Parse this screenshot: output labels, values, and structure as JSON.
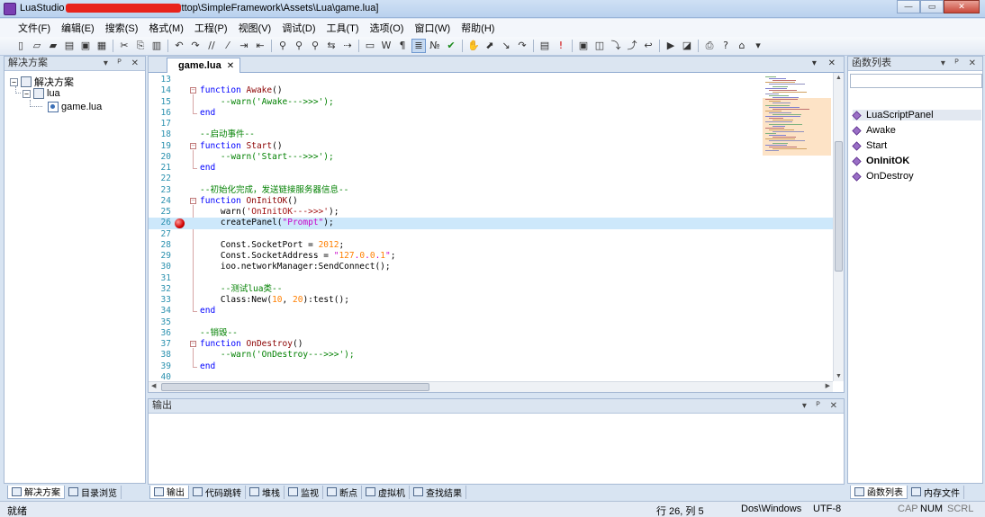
{
  "window": {
    "title_prefix": "LuaStudio",
    "title_suffix": "ttop\\SimpleFramework\\Assets\\Lua\\game.lua]",
    "minimize": "—",
    "maximize": "▭",
    "close": "✕"
  },
  "menu": [
    "文件(F)",
    "编辑(E)",
    "搜索(S)",
    "格式(M)",
    "工程(P)",
    "视图(V)",
    "调试(D)",
    "工具(T)",
    "选项(O)",
    "窗口(W)",
    "帮助(H)"
  ],
  "toolbar_icons": [
    "new-file-icon",
    "open-icon",
    "open-folder-icon",
    "open-project-icon",
    "save-icon",
    "save-all-icon",
    "sep",
    "cut-icon",
    "copy-icon",
    "paste-icon",
    "sep",
    "undo-icon",
    "redo-icon",
    "comment-icon",
    "uncomment-icon",
    "indent-icon",
    "outdent-icon",
    "sep",
    "find-icon",
    "find-next-icon",
    "find-prev-icon",
    "replace-icon",
    "goto-icon",
    "sep",
    "view-icon",
    "whitespace-icon",
    "paragraph-icon",
    "wrap-icon",
    "linenumber-icon",
    "check-icon",
    "sep",
    "hand-icon",
    "breakpoint-icon",
    "step-icon",
    "step-over-icon",
    "sep",
    "stack-icon",
    "exclamation-icon",
    "sep",
    "frame-icon",
    "watch-icon",
    "step-in-icon",
    "step-out-icon",
    "return-icon",
    "sep",
    "run-icon",
    "debug-icon",
    "sep",
    "print-icon",
    "help-icon",
    "home-icon",
    "more-icon"
  ],
  "solution": {
    "header": "解决方案",
    "root": "解决方案",
    "folder": "lua",
    "file": "game.lua"
  },
  "panel_buttons": "▾ ᴾ ✕",
  "editor": {
    "tab": "game.lua",
    "tab_close": "✕",
    "strip_buttons": "▾ ✕",
    "breakpoint_line": 26
  },
  "code": [
    {
      "n": "13",
      "t": ""
    },
    {
      "n": "14",
      "t": "function Awake()"
    },
    {
      "n": "15",
      "t": "    --warn('Awake--->>>');"
    },
    {
      "n": "16",
      "t": "end"
    },
    {
      "n": "17",
      "t": ""
    },
    {
      "n": "18",
      "t": "--启动事件--"
    },
    {
      "n": "19",
      "t": "function Start()"
    },
    {
      "n": "20",
      "t": "    --warn('Start--->>>');"
    },
    {
      "n": "21",
      "t": "end"
    },
    {
      "n": "22",
      "t": ""
    },
    {
      "n": "23",
      "t": "--初始化完成，发送链接服务器信息--"
    },
    {
      "n": "24",
      "t": "function OnInitOK()"
    },
    {
      "n": "25",
      "t": "    warn('OnInitOK--->>>');"
    },
    {
      "n": "26",
      "t": "    createPanel(\"Prompt\");"
    },
    {
      "n": "27",
      "t": ""
    },
    {
      "n": "28",
      "t": "    Const.SocketPort = 2012;"
    },
    {
      "n": "29",
      "t": "    Const.SocketAddress = \"127.0.0.1\";"
    },
    {
      "n": "30",
      "t": "    ioo.networkManager:SendConnect();"
    },
    {
      "n": "31",
      "t": ""
    },
    {
      "n": "32",
      "t": "    --测试lua类--"
    },
    {
      "n": "33",
      "t": "    Class:New(10, 20):test();"
    },
    {
      "n": "34",
      "t": "end"
    },
    {
      "n": "35",
      "t": ""
    },
    {
      "n": "36",
      "t": "--销毁--"
    },
    {
      "n": "37",
      "t": "function OnDestroy()"
    },
    {
      "n": "38",
      "t": "    --warn('OnDestroy--->>>');"
    },
    {
      "n": "39",
      "t": "end"
    },
    {
      "n": "40",
      "t": ""
    }
  ],
  "output": {
    "header": "输出"
  },
  "funclist": {
    "header": "函数列表",
    "search_value": "",
    "items": [
      "LuaScriptPanel",
      "Awake",
      "Start",
      "OnInitOK",
      "OnDestroy"
    ]
  },
  "left_bottom_tabs": [
    "解决方案",
    "目录浏览"
  ],
  "center_bottom_tabs": [
    "输出",
    "代码跳转",
    "堆栈",
    "监视",
    "断点",
    "虚拟机",
    "查找结果"
  ],
  "right_bottom_tabs": [
    "函数列表",
    "内存文件"
  ],
  "status": {
    "ready": "就绪",
    "position": "行 26, 列 5",
    "line_ending": "Dos\\Windows",
    "encoding": "UTF-8",
    "cap": "CAP",
    "num": "NUM",
    "scrl": "SCRL"
  }
}
